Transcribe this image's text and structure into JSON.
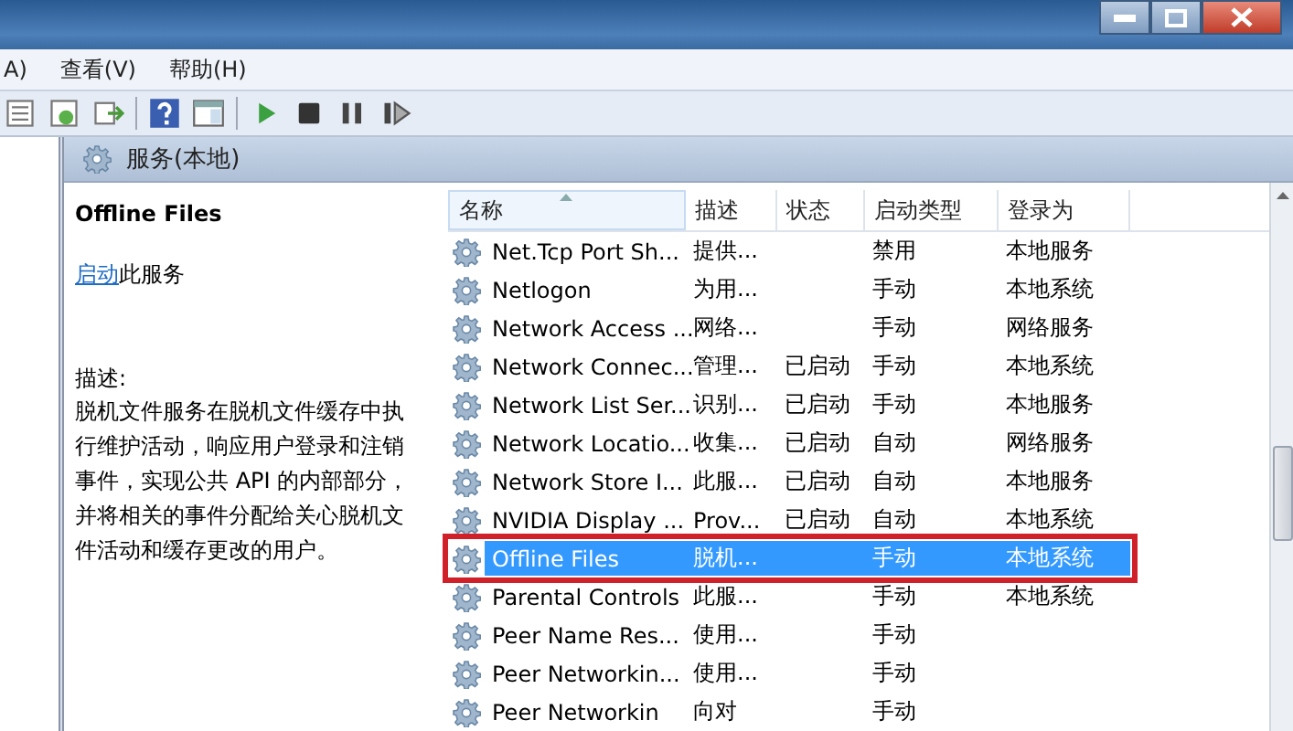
{
  "menu": [
    {
      "label": "A)"
    },
    {
      "label": "查看(V)"
    },
    {
      "label": "帮助(H)"
    }
  ],
  "panel": {
    "title": "服务(本地)"
  },
  "details": {
    "name": "Offline Files",
    "action_link": "启动",
    "action_rest": "此服务",
    "description_label": "描述:",
    "description": "脱机文件服务在脱机文件缓存中执行维护活动，响应用户登录和注销事件，实现公共 API 的内部部分，并将相关的事件分配给关心脱机文件活动和缓存更改的用户。"
  },
  "table": {
    "columns": [
      {
        "label": "名称",
        "sorted": true
      },
      {
        "label": "描述",
        "sorted": false
      },
      {
        "label": "状态",
        "sorted": false
      },
      {
        "label": "启动类型",
        "sorted": false
      },
      {
        "label": "登录为",
        "sorted": false
      }
    ],
    "rows": [
      {
        "name": "Net.Tcp Port Sh...",
        "desc": "提供...",
        "status": "",
        "startup": "禁用",
        "logon": "本地服务",
        "selected": false
      },
      {
        "name": "Netlogon",
        "desc": "为用...",
        "status": "",
        "startup": "手动",
        "logon": "本地系统",
        "selected": false
      },
      {
        "name": "Network Access ...",
        "desc": "网络...",
        "status": "",
        "startup": "手动",
        "logon": "网络服务",
        "selected": false
      },
      {
        "name": "Network Connec...",
        "desc": "管理...",
        "status": "已启动",
        "startup": "手动",
        "logon": "本地系统",
        "selected": false
      },
      {
        "name": "Network List Ser...",
        "desc": "识别...",
        "status": "已启动",
        "startup": "手动",
        "logon": "本地服务",
        "selected": false
      },
      {
        "name": "Network Locatio...",
        "desc": "收集...",
        "status": "已启动",
        "startup": "自动",
        "logon": "网络服务",
        "selected": false
      },
      {
        "name": "Network Store I...",
        "desc": "此服...",
        "status": "已启动",
        "startup": "自动",
        "logon": "本地服务",
        "selected": false
      },
      {
        "name": "NVIDIA Display ...",
        "desc": "Prov...",
        "status": "已启动",
        "startup": "自动",
        "logon": "本地系统",
        "selected": false
      },
      {
        "name": "Offline Files",
        "desc": "脱机...",
        "status": "",
        "startup": "手动",
        "logon": "本地系统",
        "selected": true
      },
      {
        "name": "Parental Controls",
        "desc": "此服...",
        "status": "",
        "startup": "手动",
        "logon": "本地系统",
        "selected": false
      },
      {
        "name": "Peer Name Res...",
        "desc": "使用...",
        "status": "",
        "startup": "手动",
        "logon": "",
        "selected": false
      },
      {
        "name": "Peer Networkin...",
        "desc": "使用...",
        "status": "",
        "startup": "手动",
        "logon": "",
        "selected": false
      },
      {
        "name": "Peer Networkin",
        "desc": "向对",
        "status": "",
        "startup": "手动",
        "logon": "",
        "selected": false
      }
    ]
  }
}
